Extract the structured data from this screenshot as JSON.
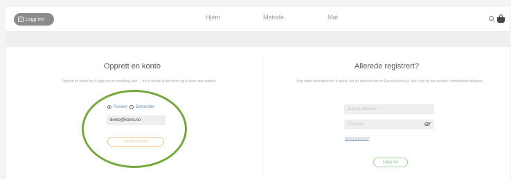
{
  "header": {
    "login_label": "Logg inn",
    "nav": [
      "Hjem",
      "Metode",
      "Mat"
    ],
    "icons": [
      "search-icon",
      "cart-icon"
    ]
  },
  "create_account": {
    "title": "Opprett en konto",
    "description": "Opprett en konto for å logge inn en bestilling eller ... fra et besøk til det neste og å spare dine pakker.",
    "radio": {
      "option_1": "Pasient",
      "option_2": "Behandler",
      "selected": "Pasient"
    },
    "field_value": "demo@konto.no",
    "button_label": "Opprett en konto"
  },
  "already_registered": {
    "title": "Allerede registrert?",
    "description": "Velg dette alternativet for å sjekke om du allerede har en Eurodiet konto (f. eks. hvis du har handlet i nettbutikken tidligere)",
    "email_placeholder": "E-post adresse",
    "password_placeholder": "Passord",
    "forgot_label": "Glemt passord?",
    "login_button_label": "Logg inn"
  },
  "colors": {
    "accent_orange": "#f0c48a",
    "accent_green": "#8cc68c",
    "highlight": "#74a83b",
    "link_blue": "#6b8fb4"
  }
}
